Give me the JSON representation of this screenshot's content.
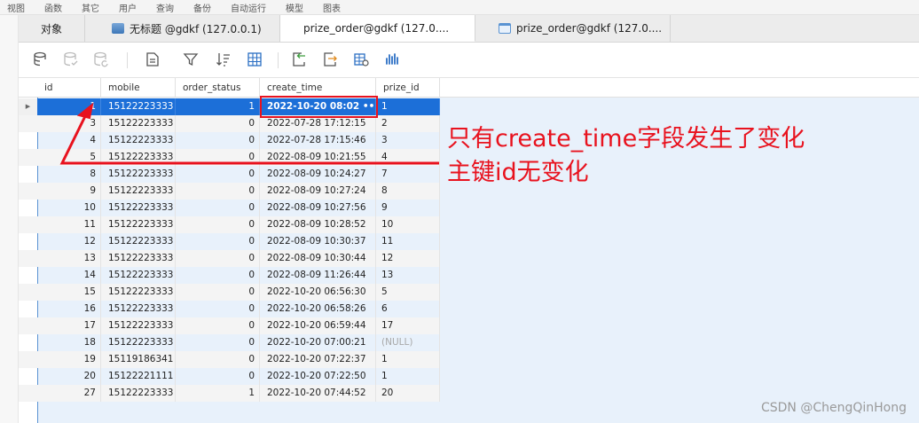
{
  "menu": [
    "视图",
    "函数",
    "其它",
    "用户",
    "查询",
    "备份",
    "自动运行",
    "模型",
    "图表"
  ],
  "tabs": [
    {
      "label": "对象",
      "icon": "none"
    },
    {
      "label": "无标题 @gdkf (127.0.0.1)",
      "icon": "query-icon"
    },
    {
      "label": "prize_order@gdkf (127.0....",
      "icon": "table-icon",
      "active": true
    },
    {
      "label": "prize_order@gdkf (127.0....",
      "icon": "query-table-icon"
    }
  ],
  "toolbar": {
    "icons": [
      "begin-transaction-icon",
      "commit-icon",
      "rollback-icon",
      "text-view-icon",
      "filter-icon",
      "sort-icon",
      "grid-view-icon",
      "import-icon",
      "export-icon",
      "data-generation-icon",
      "chart-icon"
    ]
  },
  "columns": [
    "id",
    "mobile",
    "order_status",
    "create_time",
    "prize_id"
  ],
  "rows": [
    {
      "id": "1",
      "mobile": "15122223333",
      "order_status": "1",
      "create_time": "2022-10-20 08:02 •••",
      "prize_id": "1",
      "selected": true
    },
    {
      "id": "3",
      "mobile": "15122223333",
      "order_status": "0",
      "create_time": "2022-07-28 17:12:15",
      "prize_id": "2"
    },
    {
      "id": "4",
      "mobile": "15122223333",
      "order_status": "0",
      "create_time": "2022-07-28 17:15:46",
      "prize_id": "3"
    },
    {
      "id": "5",
      "mobile": "15122223333",
      "order_status": "0",
      "create_time": "2022-08-09 10:21:55",
      "prize_id": "4"
    },
    {
      "id": "8",
      "mobile": "15122223333",
      "order_status": "0",
      "create_time": "2022-08-09 10:24:27",
      "prize_id": "7"
    },
    {
      "id": "9",
      "mobile": "15122223333",
      "order_status": "0",
      "create_time": "2022-08-09 10:27:24",
      "prize_id": "8"
    },
    {
      "id": "10",
      "mobile": "15122223333",
      "order_status": "0",
      "create_time": "2022-08-09 10:27:56",
      "prize_id": "9"
    },
    {
      "id": "11",
      "mobile": "15122223333",
      "order_status": "0",
      "create_time": "2022-08-09 10:28:52",
      "prize_id": "10"
    },
    {
      "id": "12",
      "mobile": "15122223333",
      "order_status": "0",
      "create_time": "2022-08-09 10:30:37",
      "prize_id": "11"
    },
    {
      "id": "13",
      "mobile": "15122223333",
      "order_status": "0",
      "create_time": "2022-08-09 10:30:44",
      "prize_id": "12"
    },
    {
      "id": "14",
      "mobile": "15122223333",
      "order_status": "0",
      "create_time": "2022-08-09 11:26:44",
      "prize_id": "13"
    },
    {
      "id": "15",
      "mobile": "15122223333",
      "order_status": "0",
      "create_time": "2022-10-20 06:56:30",
      "prize_id": "5"
    },
    {
      "id": "16",
      "mobile": "15122223333",
      "order_status": "0",
      "create_time": "2022-10-20 06:58:26",
      "prize_id": "6"
    },
    {
      "id": "17",
      "mobile": "15122223333",
      "order_status": "0",
      "create_time": "2022-10-20 06:59:44",
      "prize_id": "17"
    },
    {
      "id": "18",
      "mobile": "15122223333",
      "order_status": "0",
      "create_time": "2022-10-20 07:00:21",
      "prize_id": "(NULL)",
      "null_prize": true
    },
    {
      "id": "19",
      "mobile": "15119186341",
      "order_status": "0",
      "create_time": "2022-10-20 07:22:37",
      "prize_id": "1"
    },
    {
      "id": "20",
      "mobile": "15122221111",
      "order_status": "0",
      "create_time": "2022-10-20 07:22:50",
      "prize_id": "1"
    },
    {
      "id": "27",
      "mobile": "15122223333",
      "order_status": "1",
      "create_time": "2022-10-20 07:44:52",
      "prize_id": "20"
    }
  ],
  "annotation": {
    "line1": "只有create_time字段发生了变化",
    "line2": "主键id无变化",
    "color": "#e8121e"
  },
  "watermark": "CSDN @ChengQinHong",
  "colors": {
    "selection": "#1c6fd8",
    "annotation": "#e8121e"
  }
}
